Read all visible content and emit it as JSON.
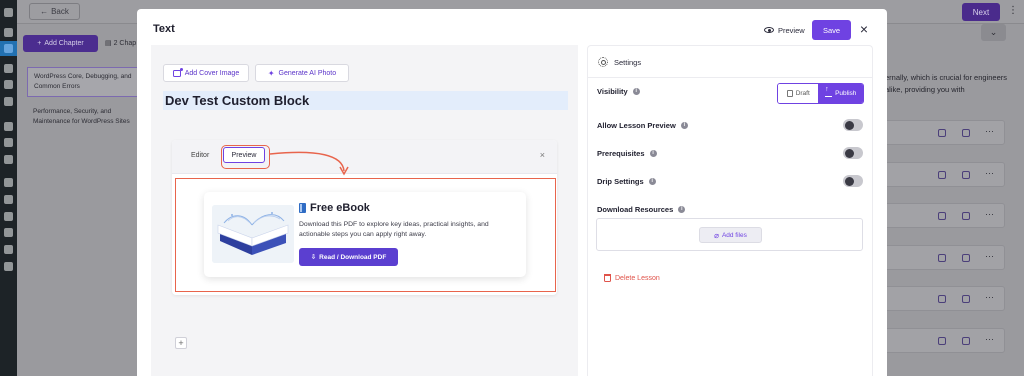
{
  "background": {
    "back_label": "Back",
    "next_label": "Next",
    "add_chapter_label": "Add Chapter",
    "chapter_count_label": "2 Chap",
    "chapters": [
      {
        "label": "WordPress Core, Debugging, and Common Errors",
        "selected": true
      },
      {
        "label": "Performance, Security, and Maintenance for WordPress Sites",
        "selected": false
      }
    ],
    "description_fragment": "ernally, which is crucial for engineers alike, providing you with"
  },
  "modal": {
    "title": "Text",
    "preview_label": "Preview",
    "save_label": "Save",
    "close_label": "×"
  },
  "editor": {
    "add_cover_label": "Add Cover Image",
    "generate_ai_label": "Generate AI Photo",
    "lesson_title": "Dev Test Custom Block",
    "tab_editor_label": "Editor",
    "tab_preview_label": "Preview",
    "block_close_label": "×",
    "add_block_label": "+"
  },
  "ebook": {
    "title": "Free eBook",
    "description": "Download this PDF to explore key ideas, practical insights, and actionable steps you can apply right away.",
    "button_label": "Read / Download PDF"
  },
  "settings": {
    "header": "Settings",
    "visibility_label": "Visibility",
    "draft_label": "Draft",
    "publish_label": "Publish",
    "selected_visibility": "Publish",
    "allow_preview_label": "Allow Lesson Preview",
    "allow_preview_on": false,
    "prerequisites_label": "Prerequisites",
    "prerequisites_on": false,
    "drip_label": "Drip Settings",
    "drip_on": false,
    "download_resources_label": "Download Resources",
    "add_files_label": "Add files",
    "delete_label": "Delete Lesson"
  },
  "colors": {
    "accent": "#6f42e2",
    "callout": "#e8644c",
    "danger": "#e0534a"
  }
}
